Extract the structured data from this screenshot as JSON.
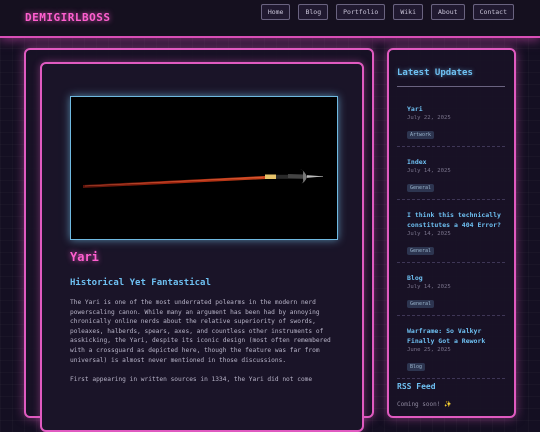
{
  "site": {
    "logo": "DEMIGIRLBOSS"
  },
  "nav": [
    "Home",
    "Blog",
    "Portfolio",
    "Wiki",
    "About",
    "Contact"
  ],
  "article": {
    "title": "Yari",
    "subtitle": "Historical Yet Fantastical",
    "paragraphs": [
      "The Yari is one of the most underrated polearms in the modern nerd powerscaling canon. While many an argument has been had by annoying chronically online nerds about the relative superiority of swords, poleaxes, halberds, spears, axes, and countless other instruments of asskicking, the Yari, despite its iconic design (most often remembered with a crossguard as depicted here, though the feature was far from universal) is almost never mentioned in those discussions.",
      "First appearing in written sources in 1334, the Yari did not come"
    ],
    "hero_image": "spear-image"
  },
  "sidebar": {
    "title": "Latest Updates",
    "updates": [
      {
        "title": "Yari",
        "date": "July 22, 2025",
        "tag": "Artwork"
      },
      {
        "title": "Index",
        "date": "July 14, 2025",
        "tag": "General"
      },
      {
        "title": "I think this technically constitutes a 404 Error?",
        "date": "July 14, 2025",
        "tag": "General"
      },
      {
        "title": "Blog",
        "date": "July 14, 2025",
        "tag": "General"
      },
      {
        "title": "Warframe: So Valkyr Finally Got a Rework",
        "date": "June 25, 2025",
        "tag": "Blog"
      }
    ],
    "rss_title": "RSS Feed",
    "rss_text": "Coming soon! ✨"
  },
  "colors": {
    "accent_pink": "#e05ac0",
    "accent_blue": "#6ec0f2",
    "background": "#140f22"
  }
}
